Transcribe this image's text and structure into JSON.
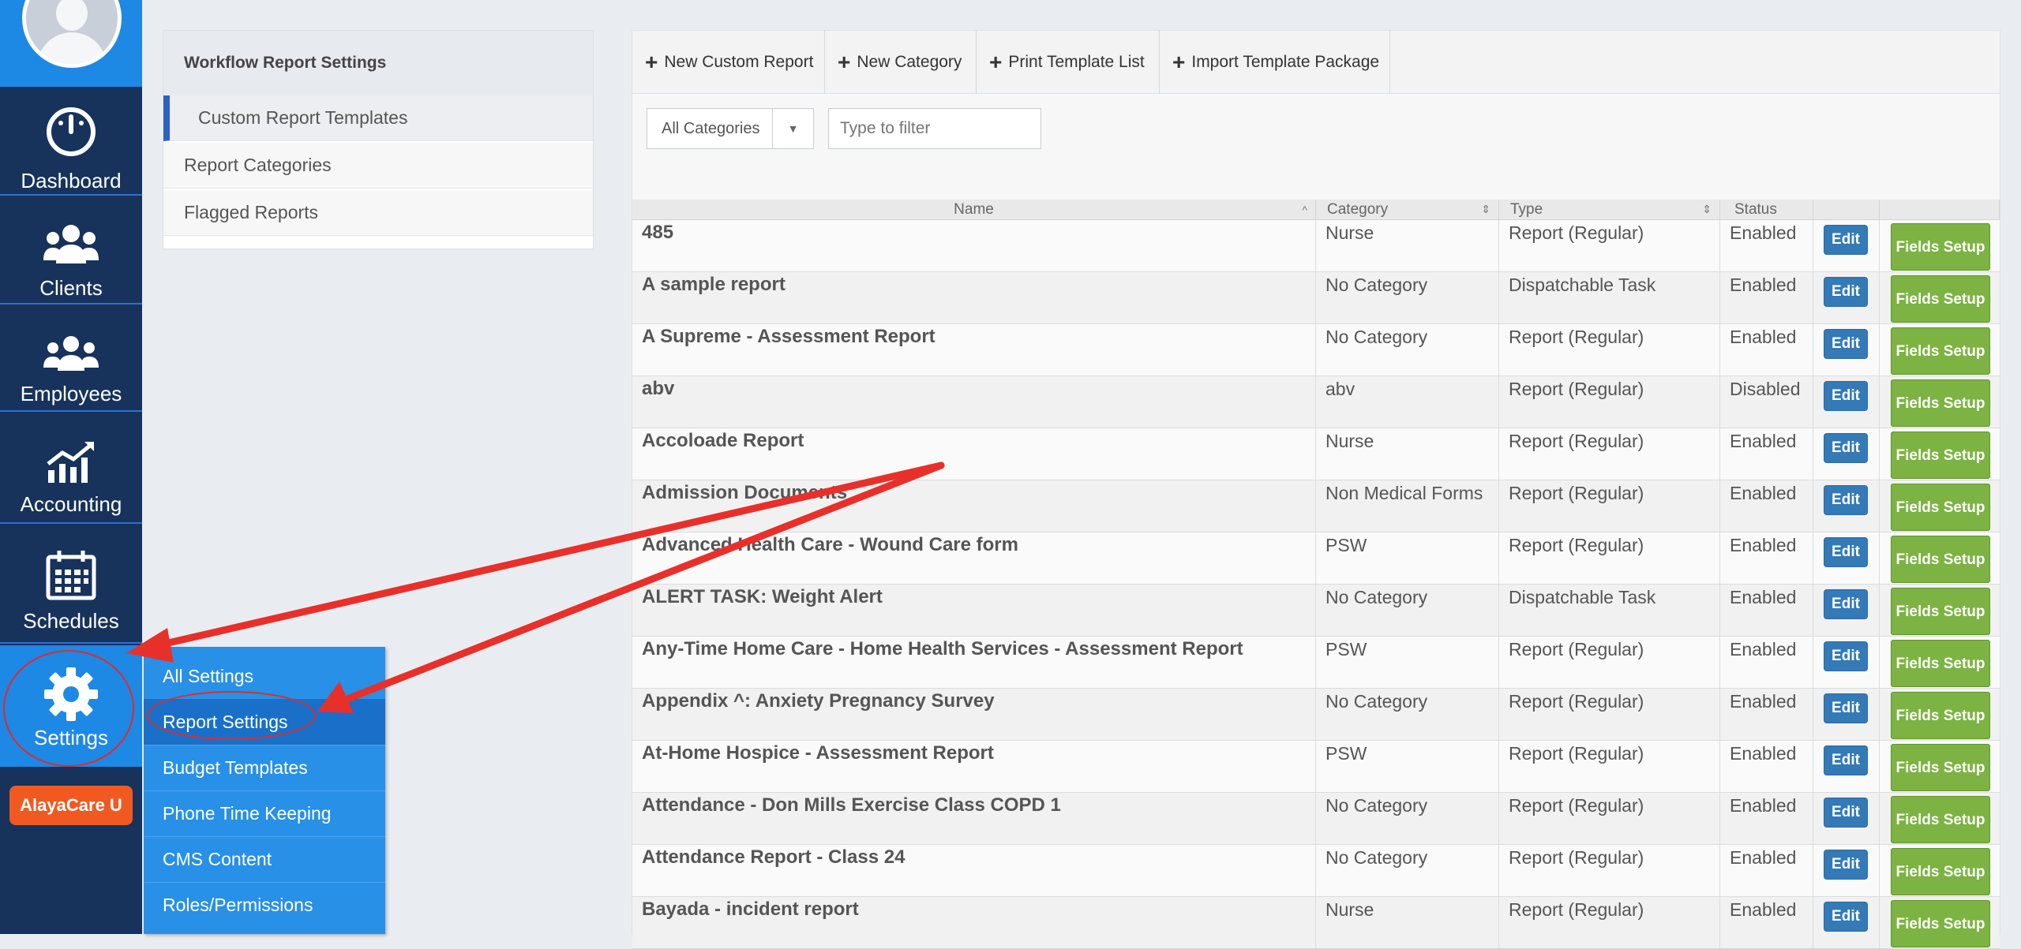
{
  "sidebar": {
    "items": [
      {
        "label": "Dashboard",
        "icon": "dashboard-icon"
      },
      {
        "label": "Clients",
        "icon": "clients-icon"
      },
      {
        "label": "Employees",
        "icon": "employees-icon"
      },
      {
        "label": "Accounting",
        "icon": "accounting-icon"
      },
      {
        "label": "Schedules",
        "icon": "calendar-icon"
      },
      {
        "label": "Settings",
        "icon": "gear-icon"
      }
    ],
    "university_label": "AlayaCare U"
  },
  "settings_menu": {
    "items": [
      "All Settings",
      "Report Settings",
      "Budget Templates",
      "Phone Time Keeping",
      "CMS Content",
      "Roles/Permissions"
    ],
    "active": "Report Settings"
  },
  "settings_panel": {
    "title": "Workflow Report Settings",
    "items": [
      "Custom Report Templates",
      "Report Categories",
      "Flagged Reports"
    ]
  },
  "toolbar": {
    "new_custom_report": "New Custom Report",
    "new_category": "New Category",
    "print_template_list": "Print Template List",
    "import_template_package": "Import Template Package"
  },
  "filters": {
    "category_value": "All Categories",
    "filter_placeholder": "Type to filter"
  },
  "table": {
    "headers": {
      "name": "Name",
      "category": "Category",
      "type": "Type",
      "status": "Status"
    },
    "edit_label": "Edit",
    "fields_setup_label": "Fields Setup",
    "rows": [
      {
        "name": "485",
        "category": "Nurse",
        "type": "Report (Regular)",
        "status": "Enabled"
      },
      {
        "name": "A sample report",
        "category": "No Category",
        "type": "Dispatchable Task",
        "status": "Enabled"
      },
      {
        "name": "A Supreme - Assessment Report",
        "category": "No Category",
        "type": "Report (Regular)",
        "status": "Enabled"
      },
      {
        "name": "abv",
        "category": "abv",
        "type": "Report (Regular)",
        "status": "Disabled"
      },
      {
        "name": "Accoloade Report",
        "category": "Nurse",
        "type": "Report (Regular)",
        "status": "Enabled"
      },
      {
        "name": "Admission Documents",
        "category": "Non Medical Forms",
        "type": "Report (Regular)",
        "status": "Enabled"
      },
      {
        "name": "Advanced Health Care - Wound Care form",
        "category": "PSW",
        "type": "Report (Regular)",
        "status": "Enabled"
      },
      {
        "name": "ALERT TASK: Weight Alert",
        "category": "No Category",
        "type": "Dispatchable Task",
        "status": "Enabled"
      },
      {
        "name": "Any-Time Home Care - Home Health Services - Assessment Report",
        "category": "PSW",
        "type": "Report (Regular)",
        "status": "Enabled"
      },
      {
        "name": "Appendix ^: Anxiety Pregnancy Survey",
        "category": "No Category",
        "type": "Report (Regular)",
        "status": "Enabled"
      },
      {
        "name": "At-Home Hospice - Assessment Report",
        "category": "PSW",
        "type": "Report (Regular)",
        "status": "Enabled"
      },
      {
        "name": "Attendance - Don Mills Exercise Class COPD 1",
        "category": "No Category",
        "type": "Report (Regular)",
        "status": "Enabled"
      },
      {
        "name": "Attendance Report - Class 24",
        "category": "No Category",
        "type": "Report (Regular)",
        "status": "Enabled"
      },
      {
        "name": "Bayada - incident report",
        "category": "Nurse",
        "type": "Report (Regular)",
        "status": "Enabled"
      }
    ]
  },
  "annotation_color": "#e8302a"
}
